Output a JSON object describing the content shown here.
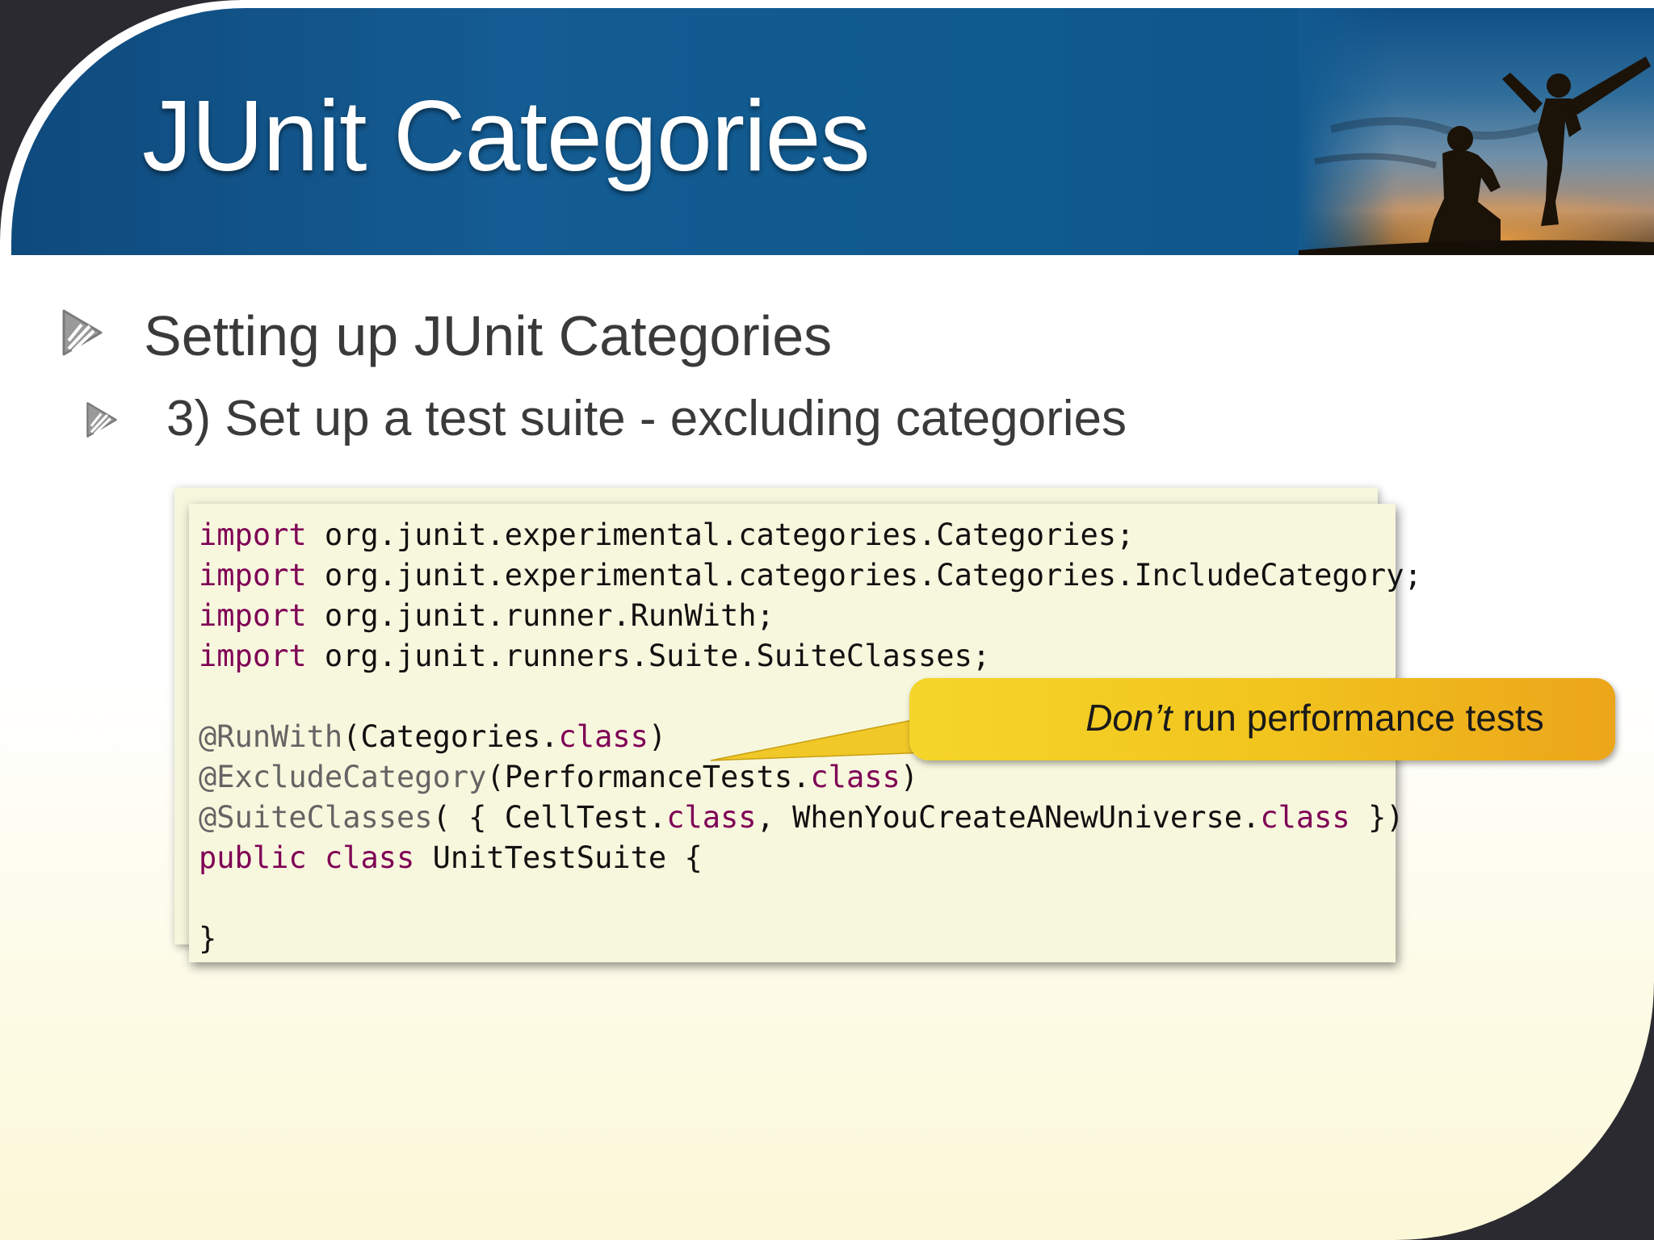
{
  "slide": {
    "title": "JUnit Categories",
    "bullets": [
      {
        "text": "Setting up JUnit Categories"
      },
      {
        "text": "3) Set up a test suite - excluding categories"
      }
    ]
  },
  "code": {
    "lines": [
      [
        {
          "t": "import",
          "c": "kw"
        },
        {
          "t": " org.junit.experimental.categories.Categories;",
          "c": ""
        }
      ],
      [
        {
          "t": "import",
          "c": "kw"
        },
        {
          "t": " org.junit.experimental.categories.Categories.IncludeCategory;",
          "c": ""
        }
      ],
      [
        {
          "t": "import",
          "c": "kw"
        },
        {
          "t": " org.junit.runner.RunWith;",
          "c": ""
        }
      ],
      [
        {
          "t": "import",
          "c": "kw"
        },
        {
          "t": " org.junit.runners.Suite.SuiteClasses;",
          "c": ""
        }
      ],
      [],
      [
        {
          "t": "@RunWith",
          "c": "ann"
        },
        {
          "t": "(Categories.",
          "c": ""
        },
        {
          "t": "class",
          "c": "kw"
        },
        {
          "t": ")",
          "c": ""
        }
      ],
      [
        {
          "t": "@ExcludeCategory",
          "c": "ann"
        },
        {
          "t": "(PerformanceTests.",
          "c": ""
        },
        {
          "t": "class",
          "c": "kw"
        },
        {
          "t": ")",
          "c": ""
        }
      ],
      [
        {
          "t": "@SuiteClasses",
          "c": "ann"
        },
        {
          "t": "( { CellTest.",
          "c": ""
        },
        {
          "t": "class",
          "c": "kw"
        },
        {
          "t": ", WhenYouCreateANewUniverse.",
          "c": ""
        },
        {
          "t": "class",
          "c": "kw"
        },
        {
          "t": " })",
          "c": ""
        }
      ],
      [
        {
          "t": "public",
          "c": "kw"
        },
        {
          "t": " ",
          "c": ""
        },
        {
          "t": "class",
          "c": "kw"
        },
        {
          "t": " UnitTestSuite {",
          "c": ""
        }
      ],
      [],
      [
        {
          "t": "}",
          "c": ""
        }
      ]
    ]
  },
  "callout": {
    "emphasis": "Don’t",
    "rest": " run performance tests"
  },
  "colors": {
    "keyword": "#7f0055",
    "annotation": "#646464",
    "header_blue": "#145c93",
    "callout_yellow": "#f2c51e"
  },
  "icons": [
    "bullet-arrow-icon"
  ]
}
